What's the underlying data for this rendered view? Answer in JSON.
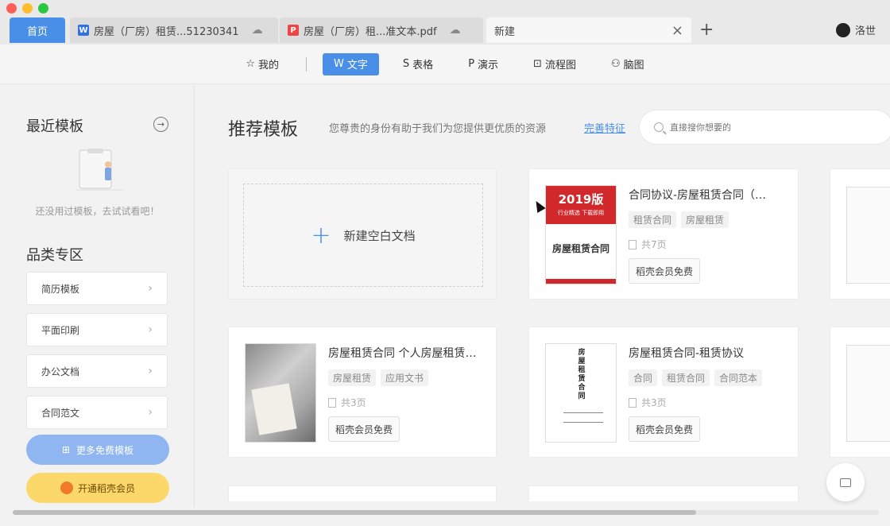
{
  "tabs": {
    "home": "首页",
    "doc": "房屋（厂房）租赁...51230341",
    "pdf": "房屋（厂房）租...准文本.pdf",
    "new": "新建"
  },
  "user": {
    "name": "洛世"
  },
  "toolbar": {
    "mine": "我的",
    "writer": "文字",
    "sheet": "表格",
    "slides": "演示",
    "flow": "流程图",
    "mind": "脑图"
  },
  "sidebar": {
    "recent_title": "最近模板",
    "empty_text": "还没用过模板，去试试看吧！",
    "category_title": "品类专区",
    "categories": [
      "简历模板",
      "平面印刷",
      "办公文档",
      "合同范文"
    ],
    "more_button": "更多免费模板",
    "vip_button": "开通稻壳会员"
  },
  "main": {
    "title": "推荐模板",
    "subtitle": "您尊贵的身份有助于我们为您提供更优质的资源",
    "link": "完善特征",
    "search_placeholder": "直接搜你想要的",
    "blank_label": "新建空白文档"
  },
  "templates": [
    {
      "title": "合同协议-房屋租赁合同（…",
      "tags": [
        "租赁合同",
        "房屋租赁"
      ],
      "pages": "共7页",
      "button": "稻壳会员免费",
      "thumb_year": "2019版",
      "thumb_sub": "行业精选 下载即用",
      "thumb_title": "房屋租赁合同"
    },
    {
      "title": "房屋租赁合同 个人房屋租赁…",
      "tags": [
        "房屋租赁",
        "应用文书"
      ],
      "pages": "共3页",
      "button": "稻壳会员免费"
    },
    {
      "title": "房屋租赁合同-租赁协议",
      "tags": [
        "合同",
        "租赁合同",
        "合同范本"
      ],
      "pages": "共3页",
      "button": "稻壳会员免费",
      "thumb_title": "房屋租赁合同"
    }
  ],
  "colors": {
    "accent": "#4a8fe7",
    "vip": "#fcd86b",
    "thumb_red": "#d0282b"
  }
}
